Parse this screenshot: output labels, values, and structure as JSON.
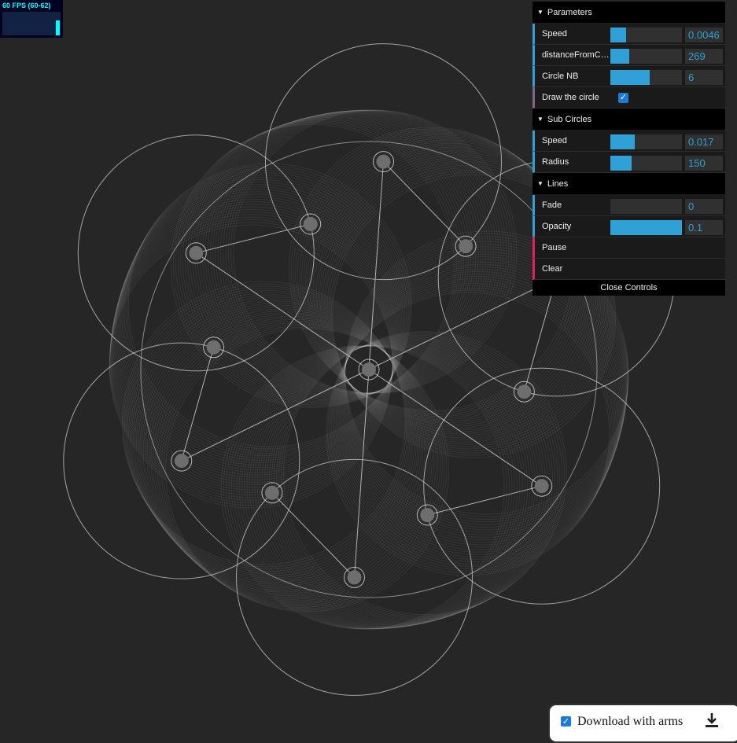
{
  "fps": {
    "label": "60 FPS (60-62)",
    "level": 0.62
  },
  "controls": {
    "parameters": {
      "title": "Parameters",
      "speed": {
        "label": "Speed",
        "value": "0.0046",
        "fill": 0.22
      },
      "distance": {
        "label": "distanceFromCenter",
        "value": "269",
        "fill": 0.26
      },
      "circle_nb": {
        "label": "Circle NB",
        "value": "6",
        "fill": 0.55
      },
      "draw_circle": {
        "label": "Draw the circle",
        "checked": true
      }
    },
    "sub_circles": {
      "title": "Sub Circles",
      "speed": {
        "label": "Speed",
        "value": "0.017",
        "fill": 0.34
      },
      "radius": {
        "label": "Radius",
        "value": "150",
        "fill": 0.3
      }
    },
    "lines": {
      "title": "Lines",
      "fade": {
        "label": "Fade",
        "value": "0",
        "fill": 0
      },
      "opacity": {
        "label": "Opacity",
        "value": "0.1",
        "fill": 1
      },
      "pause": {
        "label": "Pause"
      },
      "clear": {
        "label": "Clear"
      }
    },
    "close_label": "Close Controls"
  },
  "download": {
    "label": "Download with arms",
    "checked": true,
    "icon": "download-icon"
  },
  "colors": {
    "background": "#262626",
    "accent": "#2fa1d6",
    "fps": "#00ffff"
  }
}
